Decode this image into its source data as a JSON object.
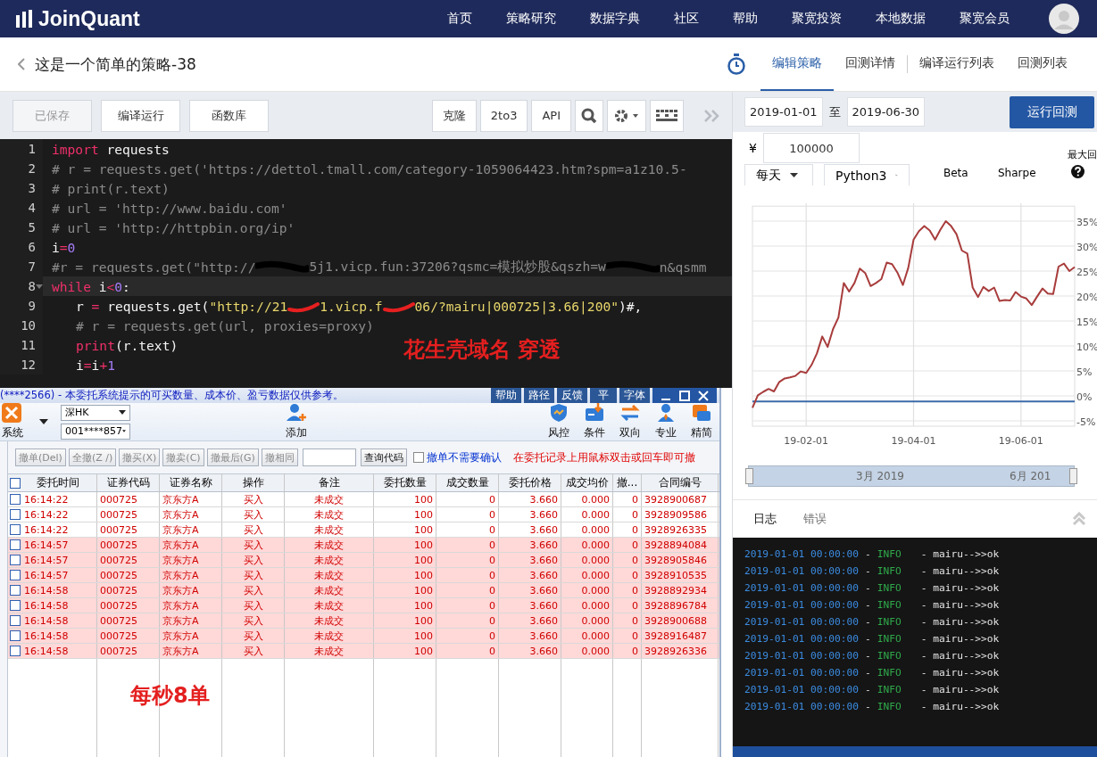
{
  "nav": {
    "logo": "JoinQuant",
    "items": [
      "首页",
      "策略研究",
      "数据字典",
      "社区",
      "帮助",
      "聚宽投资",
      "本地数据",
      "聚宽会员"
    ]
  },
  "header": {
    "title": "这是一个简单的策略-38",
    "tabs": [
      {
        "label": "编辑策略",
        "selected": true
      },
      {
        "label": "回测详情",
        "selected": false
      },
      {
        "label": "编译运行列表",
        "selected": false
      },
      {
        "label": "回测列表",
        "selected": false
      }
    ]
  },
  "toolbar": {
    "left": [
      {
        "label": "已保存",
        "disabled": true
      },
      {
        "label": "编译运行",
        "disabled": false
      },
      {
        "label": "函数库",
        "disabled": false
      }
    ],
    "right": [
      "克隆",
      "2to3",
      "API"
    ]
  },
  "editor": {
    "lines": [
      {
        "number": "1",
        "active": false,
        "indented": false,
        "foldable": false,
        "tokens": [
          {
            "kind": "kw",
            "text": "import"
          },
          {
            "kind": "plain",
            "text": " requests"
          }
        ]
      },
      {
        "number": "2",
        "active": false,
        "indented": false,
        "foldable": false,
        "tokens": [
          {
            "kind": "comment",
            "text": "# r = requests.get('https://dettol.tmall.com/category-1059064423.htm?spm=a1z10.5-"
          }
        ]
      },
      {
        "number": "3",
        "active": false,
        "indented": false,
        "foldable": false,
        "tokens": [
          {
            "kind": "comment",
            "text": "# print(r.text)"
          }
        ]
      },
      {
        "number": "4",
        "active": false,
        "indented": false,
        "foldable": false,
        "tokens": [
          {
            "kind": "comment",
            "text": "# url = 'http://www.baidu.com'"
          }
        ]
      },
      {
        "number": "5",
        "active": false,
        "indented": false,
        "foldable": false,
        "tokens": [
          {
            "kind": "comment",
            "text": "# url = 'http://httpbin.org/ip'"
          }
        ]
      },
      {
        "number": "6",
        "active": false,
        "indented": false,
        "foldable": false,
        "tokens": [
          {
            "kind": "plain",
            "text": "i"
          },
          {
            "kind": "op",
            "text": "="
          },
          {
            "kind": "num",
            "text": "0"
          }
        ]
      },
      {
        "number": "7",
        "active": false,
        "indented": false,
        "foldable": false,
        "tokens": [
          {
            "kind": "comment",
            "text": "#r = requests.get(\"http://"
          },
          {
            "kind": "redacted"
          },
          {
            "kind": "comment",
            "text": "5j1.vicp.fun:37206?qsmc=模拟炒股&qszh=w"
          },
          {
            "kind": "redacted"
          },
          {
            "kind": "comment",
            "text": "n&qsmm"
          }
        ]
      },
      {
        "number": "8",
        "active": true,
        "indented": false,
        "foldable": true,
        "tokens": [
          {
            "kind": "kw",
            "text": "while"
          },
          {
            "kind": "plain",
            "text": " i"
          },
          {
            "kind": "op",
            "text": "<"
          },
          {
            "kind": "num",
            "text": "0"
          },
          {
            "kind": "plain",
            "text": ":"
          }
        ]
      },
      {
        "number": "9",
        "active": false,
        "indented": true,
        "foldable": false,
        "tokens": [
          {
            "kind": "plain",
            "text": "r "
          },
          {
            "kind": "op",
            "text": "="
          },
          {
            "kind": "plain",
            "text": " requests.get("
          },
          {
            "kind": "str",
            "text": "\"http://21"
          },
          {
            "kind": "scrawl"
          },
          {
            "kind": "str",
            "text": "1.vicp.f"
          },
          {
            "kind": "scrawl"
          },
          {
            "kind": "str",
            "text": "06/?mairu|000725|3.66|200\""
          },
          {
            "kind": "plain",
            "text": ")#,"
          }
        ]
      },
      {
        "number": "10",
        "active": false,
        "indented": true,
        "foldable": false,
        "tokens": [
          {
            "kind": "comment",
            "text": "# r = requests.get(url, proxies=proxy)"
          }
        ]
      },
      {
        "number": "11",
        "active": false,
        "indented": true,
        "foldable": false,
        "tokens": [
          {
            "kind": "kw",
            "text": "print"
          },
          {
            "kind": "plain",
            "text": "(r.text)"
          }
        ]
      },
      {
        "number": "12",
        "active": false,
        "indented": true,
        "foldable": false,
        "tokens": [
          {
            "kind": "plain",
            "text": "i"
          },
          {
            "kind": "op",
            "text": "="
          },
          {
            "kind": "plain",
            "text": "i"
          },
          {
            "kind": "op",
            "text": "+"
          },
          {
            "kind": "num",
            "text": "1"
          }
        ]
      }
    ]
  },
  "annotations": [
    {
      "text": "花生壳域名 穿透"
    },
    {
      "text": "每秒8单"
    }
  ],
  "trade_window": {
    "title": "(****2566) - 本委托系统提示的可买数量、成本价、盈亏数据仅供参考。",
    "title_buttons": [
      "帮助",
      "路径",
      "反馈",
      "平",
      "字体"
    ],
    "system_label": "系统",
    "market": "深HK",
    "account": "001****857",
    "add_label": "添加",
    "tools": [
      {
        "kind": "shield",
        "label": "风控"
      },
      {
        "kind": "condition",
        "label": "条件"
      },
      {
        "kind": "swap",
        "label": "双向"
      },
      {
        "kind": "person",
        "label": "专业"
      },
      {
        "kind": "compact",
        "label": "精简"
      }
    ],
    "cancel_buttons": [
      {
        "label": "撤单(Del)",
        "disabled": true
      },
      {
        "label": "全撤(Z /)",
        "disabled": true
      },
      {
        "label": "撤买(X)",
        "disabled": true
      },
      {
        "label": "撤卖(C)",
        "disabled": true
      },
      {
        "label": "撤最后(G)",
        "disabled": true
      },
      {
        "label": "撤相同",
        "disabled": true
      }
    ],
    "query_button": "查询代码",
    "confirm_option": {
      "label": "撤单不需要确认",
      "checked": false
    },
    "hint": "在委托记录上用鼠标双击或回车即可撤",
    "table": {
      "all_checked": false,
      "columns": [
        "委托时间",
        "证券代码",
        "证券名称",
        "操作",
        "备注",
        "委托数量",
        "成交数量",
        "委托价格",
        "成交均价",
        "撤...",
        "合同编号"
      ],
      "rows": [
        {
          "checked": false,
          "highlighted": false,
          "cells": [
            "16:14:22",
            "000725",
            "京东方A",
            "买入",
            "未成交",
            "100",
            "0",
            "3.660",
            "0.000",
            "0",
            "3928900687"
          ]
        },
        {
          "checked": false,
          "highlighted": false,
          "cells": [
            "16:14:22",
            "000725",
            "京东方A",
            "买入",
            "未成交",
            "100",
            "0",
            "3.660",
            "0.000",
            "0",
            "3928909586"
          ]
        },
        {
          "checked": false,
          "highlighted": false,
          "cells": [
            "16:14:22",
            "000725",
            "京东方A",
            "买入",
            "未成交",
            "100",
            "0",
            "3.660",
            "0.000",
            "0",
            "3928926335"
          ]
        },
        {
          "checked": false,
          "highlighted": true,
          "cells": [
            "16:14:57",
            "000725",
            "京东方A",
            "买入",
            "未成交",
            "100",
            "0",
            "3.660",
            "0.000",
            "0",
            "3928894084"
          ]
        },
        {
          "checked": false,
          "highlighted": true,
          "cells": [
            "16:14:57",
            "000725",
            "京东方A",
            "买入",
            "未成交",
            "100",
            "0",
            "3.660",
            "0.000",
            "0",
            "3928905846"
          ]
        },
        {
          "checked": false,
          "highlighted": true,
          "cells": [
            "16:14:57",
            "000725",
            "京东方A",
            "买入",
            "未成交",
            "100",
            "0",
            "3.660",
            "0.000",
            "0",
            "3928910535"
          ]
        },
        {
          "checked": false,
          "highlighted": true,
          "cells": [
            "16:14:58",
            "000725",
            "京东方A",
            "买入",
            "未成交",
            "100",
            "0",
            "3.660",
            "0.000",
            "0",
            "3928892934"
          ]
        },
        {
          "checked": false,
          "highlighted": true,
          "cells": [
            "16:14:58",
            "000725",
            "京东方A",
            "买入",
            "未成交",
            "100",
            "0",
            "3.660",
            "0.000",
            "0",
            "3928896784"
          ]
        },
        {
          "checked": false,
          "highlighted": true,
          "cells": [
            "16:14:58",
            "000725",
            "京东方A",
            "买入",
            "未成交",
            "100",
            "0",
            "3.660",
            "0.000",
            "0",
            "3928900688"
          ]
        },
        {
          "checked": false,
          "highlighted": true,
          "cells": [
            "16:14:58",
            "000725",
            "京东方A",
            "买入",
            "未成交",
            "100",
            "0",
            "3.660",
            "0.000",
            "0",
            "3928916487"
          ]
        },
        {
          "checked": false,
          "highlighted": true,
          "cells": [
            "16:14:58",
            "000725",
            "京东方A",
            "买入",
            "未成交",
            "100",
            "0",
            "3.660",
            "0.000",
            "0",
            "3928926336"
          ]
        }
      ]
    }
  },
  "backtest": {
    "start_date": "2019-01-01",
    "to": "至",
    "end_date": "2019-06-30",
    "run_button": "运行回测",
    "currency": "¥",
    "capital": "100000",
    "frequency": "每天",
    "language": "Python3",
    "metrics": [
      "Beta",
      "Sharpe",
      "最大回"
    ],
    "chart_data": {
      "type": "line",
      "categories": [
        null,
        null,
        null,
        null,
        null,
        null,
        null,
        null,
        null,
        null,
        "19-02-01",
        null,
        null,
        null,
        null,
        null,
        null,
        null,
        null,
        null,
        null,
        null,
        null,
        null,
        null,
        null,
        null,
        null,
        null,
        null,
        "19-04-01",
        null,
        null,
        null,
        null,
        null,
        null,
        null,
        null,
        null,
        null,
        null,
        null,
        null,
        null,
        null,
        null,
        null,
        null,
        null,
        "19-06-01",
        null,
        null,
        null,
        null,
        null,
        null,
        null,
        null,
        null,
        null
      ],
      "series": [
        {
          "color": "#a83c3c",
          "values": [
            -2.4,
            0.1,
            0.8,
            1.4,
            0.9,
            2.8,
            3.5,
            3.7,
            4,
            4.9,
            4.6,
            6.2,
            8.5,
            11.9,
            9.8,
            13.4,
            15.7,
            22.6,
            20.9,
            22.6,
            25.5,
            24.6,
            22,
            22.6,
            23.4,
            26.7,
            26.4,
            24.7,
            22.2,
            25.6,
            31.3,
            33,
            34,
            33.1,
            31.3,
            33.3,
            35,
            34,
            32.4,
            29.1,
            28.5,
            21.7,
            19.8,
            21.8,
            21,
            21.7,
            19,
            19.2,
            19.1,
            20.8,
            19.9,
            19.5,
            18.2,
            19.9,
            21.5,
            20.5,
            20.4,
            25.9,
            26.5,
            25,
            25.8
          ]
        },
        {
          "color": "#3d6aa8",
          "values": [
            -1.1,
            -1.1,
            -1.1,
            -1.1,
            -1.1,
            -1.1,
            -1.1,
            -1.1,
            -1.1,
            -1.1,
            -1.1,
            -1.1,
            -1.1,
            -1.1,
            -1.1,
            -1.1,
            -1.1,
            -1.1,
            -1.1,
            -1.1,
            -1.1,
            -1.1,
            -1.1,
            -1.1,
            -1.1,
            -1.1,
            -1.1,
            -1.1,
            -1.1,
            -1.1,
            -1.1,
            -1.1,
            -1.1,
            -1.1,
            -1.1,
            -1.1,
            -1.1,
            -1.1,
            -1.1,
            -1.1,
            -1.1,
            -1.1,
            -1.1,
            -1.1,
            -1.1,
            -1.1,
            -1.1,
            -1.1,
            -1.1,
            -1.1,
            -1.1,
            -1.1,
            -1.1,
            -1.1,
            -1.1,
            -1.1,
            -1.1,
            -1.1,
            -1.1,
            -1.1,
            -1.1
          ]
        }
      ],
      "grid": true,
      "ylim": [
        -5,
        38
      ],
      "yticks": [
        {
          "value": 35,
          "label": "35%"
        },
        {
          "value": 30,
          "label": "30%"
        },
        {
          "value": 25,
          "label": "25%"
        },
        {
          "value": 20,
          "label": "20%"
        },
        {
          "value": 15,
          "label": "15%"
        },
        {
          "value": 10,
          "label": "10%"
        },
        {
          "value": 5,
          "label": "5%"
        },
        {
          "value": 0,
          "label": "0%"
        },
        {
          "value": -5,
          "label": "-5%"
        }
      ]
    },
    "navigator": [
      "3月 2019",
      "6月 201"
    ]
  },
  "log": {
    "tabs": [
      {
        "label": "日志",
        "selected": true
      },
      {
        "label": "错误",
        "selected": false
      }
    ],
    "entries": [
      {
        "time": "2019-01-01 00:00:00",
        "sep": "-",
        "kind": "info",
        "level": "INFO",
        "message": "- mairu-->>ok"
      },
      {
        "time": "2019-01-01 00:00:00",
        "sep": "-",
        "kind": "info",
        "level": "INFO",
        "message": "- mairu-->>ok"
      },
      {
        "time": "2019-01-01 00:00:00",
        "sep": "-",
        "kind": "info",
        "level": "INFO",
        "message": "- mairu-->>ok"
      },
      {
        "time": "2019-01-01 00:00:00",
        "sep": "-",
        "kind": "info",
        "level": "INFO",
        "message": "- mairu-->>ok"
      },
      {
        "time": "2019-01-01 00:00:00",
        "sep": "-",
        "kind": "info",
        "level": "INFO",
        "message": "- mairu-->>ok"
      },
      {
        "time": "2019-01-01 00:00:00",
        "sep": "-",
        "kind": "info",
        "level": "INFO",
        "message": "- mairu-->>ok"
      },
      {
        "time": "2019-01-01 00:00:00",
        "sep": "-",
        "kind": "info",
        "level": "INFO",
        "message": "- mairu-->>ok"
      },
      {
        "time": "2019-01-01 00:00:00",
        "sep": "-",
        "kind": "info",
        "level": "INFO",
        "message": "- mairu-->>ok"
      },
      {
        "time": "2019-01-01 00:00:00",
        "sep": "-",
        "kind": "info",
        "level": "INFO",
        "message": "- mairu-->>ok"
      },
      {
        "time": "2019-01-01 00:00:00",
        "sep": "-",
        "kind": "info",
        "level": "INFO",
        "message": "- mairu-->>ok"
      }
    ]
  }
}
